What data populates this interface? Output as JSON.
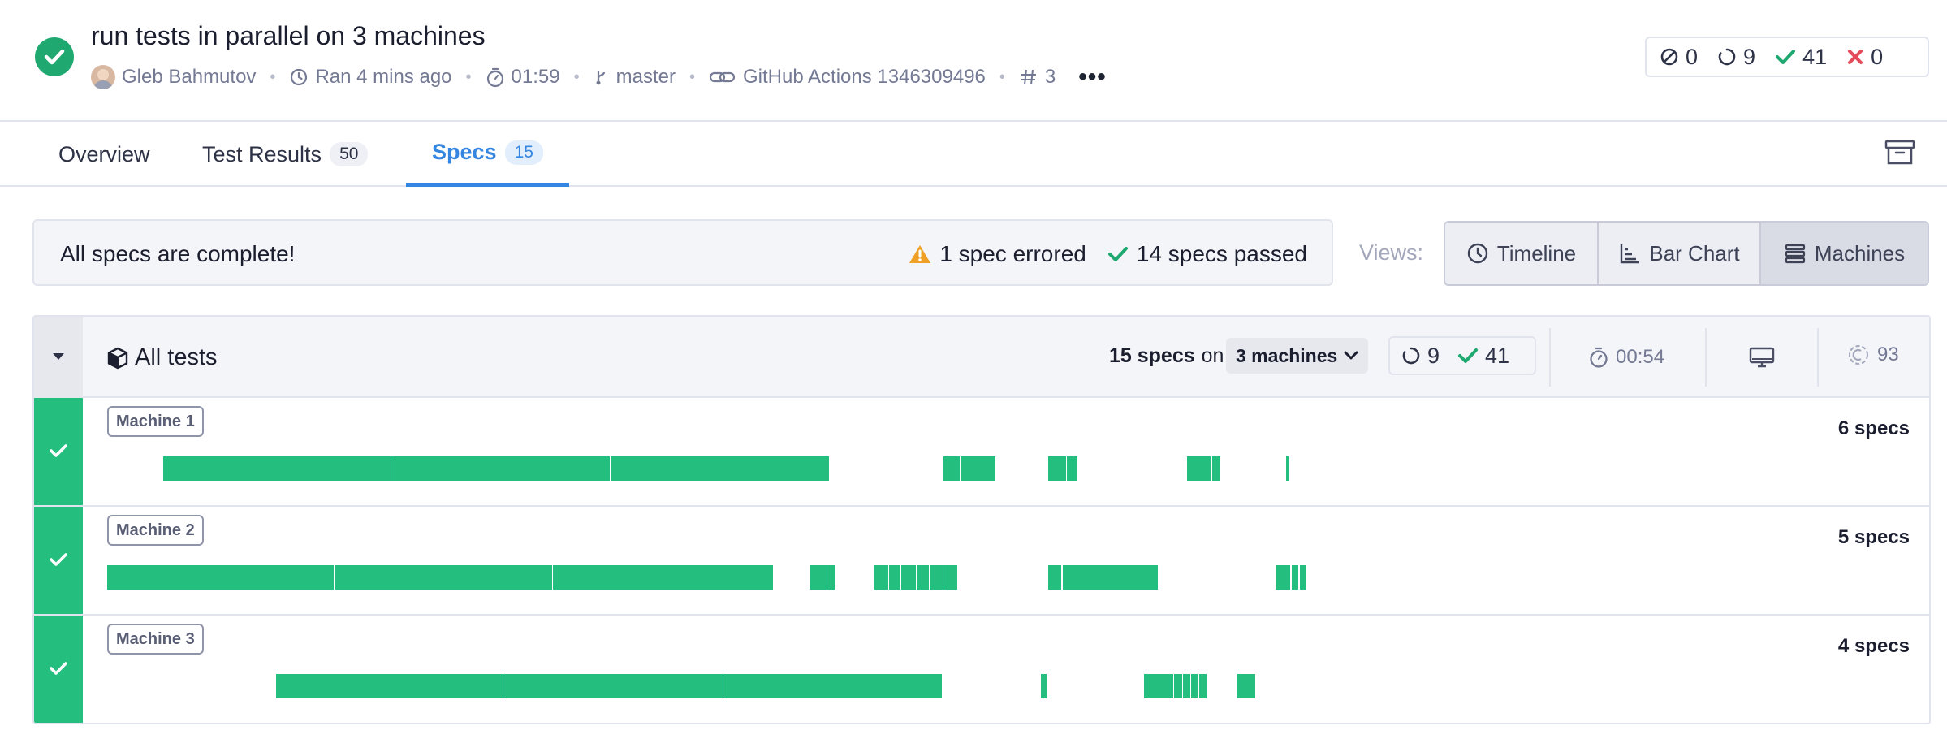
{
  "header": {
    "title": "run tests in parallel on 3 machines",
    "author": "Gleb Bahmutov",
    "ran": "Ran 4 mins ago",
    "duration": "01:59",
    "branch": "master",
    "ci": "GitHub Actions 1346309496",
    "number": "3",
    "more": "•••",
    "counts": {
      "skipped": "0",
      "pending": "9",
      "passed": "41",
      "failed": "0"
    },
    "colors": {
      "passed": "#1fa971",
      "failed": "#e44b5a",
      "accent": "#3486e0"
    }
  },
  "tabs": [
    {
      "label": "Overview",
      "badge": ""
    },
    {
      "label": "Test Results",
      "badge": "50"
    },
    {
      "label": "Specs",
      "badge": "15"
    }
  ],
  "summary": {
    "complete": "All specs are complete!",
    "errored": "1 spec errored",
    "passed": "14 specs passed"
  },
  "views": {
    "label": "Views:",
    "buttons": [
      "Timeline",
      "Bar Chart",
      "Machines"
    ],
    "selected": "Machines"
  },
  "group": {
    "title": "All tests",
    "specs_count": "15 specs",
    "on": "on",
    "machines": "3 machines",
    "pending": "9",
    "passed": "41",
    "duration": "00:54",
    "flake": "93"
  },
  "machines": [
    {
      "label": "Machine 1",
      "specs": "6 specs",
      "bars": [
        [
          0.031,
          0.157
        ],
        [
          0.1575,
          0.279
        ],
        [
          0.2795,
          0.4005
        ],
        [
          0.464,
          0.473
        ],
        [
          0.4735,
          0.493
        ],
        [
          0.522,
          0.532
        ],
        [
          0.5325,
          0.5385
        ],
        [
          0.599,
          0.6125
        ],
        [
          0.613,
          0.6175
        ],
        [
          0.654,
          0.6552
        ]
      ]
    },
    {
      "label": "Machine 2",
      "specs": "5 specs",
      "bars": [
        [
          0.0,
          0.1255
        ],
        [
          0.126,
          0.247
        ],
        [
          0.2475,
          0.3695
        ],
        [
          0.39,
          0.399
        ],
        [
          0.3995,
          0.4035
        ],
        [
          0.4255,
          0.4335
        ],
        [
          0.434,
          0.44
        ],
        [
          0.4405,
          0.4485
        ],
        [
          0.449,
          0.456
        ],
        [
          0.4565,
          0.4635
        ],
        [
          0.464,
          0.4715
        ],
        [
          0.522,
          0.5295
        ],
        [
          0.53,
          0.583
        ],
        [
          0.648,
          0.6565
        ],
        [
          0.657,
          0.661
        ],
        [
          0.6615,
          0.665
        ]
      ]
    },
    {
      "label": "Machine 3",
      "specs": "4 specs",
      "bars": [
        [
          0.0935,
          0.2195
        ],
        [
          0.22,
          0.3415
        ],
        [
          0.342,
          0.463
        ],
        [
          0.518,
          0.5187
        ],
        [
          0.5192,
          0.5199
        ],
        [
          0.5204,
          0.5211
        ],
        [
          0.575,
          0.5915
        ],
        [
          0.592,
          0.5965
        ],
        [
          0.597,
          0.601
        ],
        [
          0.6015,
          0.6055
        ],
        [
          0.606,
          0.61
        ],
        [
          0.627,
          0.637
        ]
      ]
    }
  ]
}
